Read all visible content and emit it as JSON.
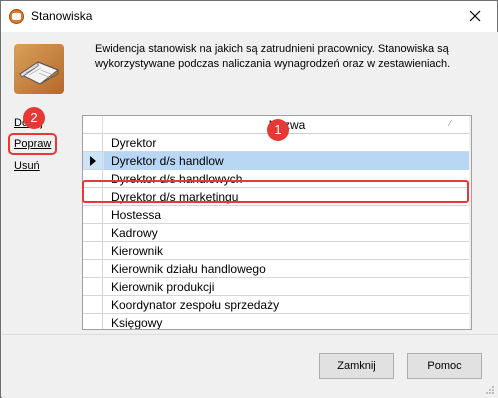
{
  "window": {
    "title": "Stanowiska",
    "close_glyph": "✕"
  },
  "description": "Ewidencja stanowisk na jakich są zatrudnieni pracownicy. Stanowiska są wykorzystywane podczas naliczania wynagrodzeń oraz w zestawieniach.",
  "side_actions": {
    "add": "Dodaj",
    "edit": "Popraw",
    "delete": "Usuń"
  },
  "grid": {
    "column": "Nazwa",
    "rows": [
      "Dyrektor",
      "Dyrektor d/s handlow",
      "Dyrektor d/s handlowych",
      "Dyrektor d/s marketingu",
      "Hostessa",
      "Kadrowy",
      "Kierownik",
      "Kierownik działu handlowego",
      "Kierownik produkcji",
      "Koordynator zespołu sprzedaży",
      "Księgowy"
    ],
    "selected_index": 1
  },
  "badges": {
    "grid_badge": "1",
    "edit_badge": "2"
  },
  "footer": {
    "close_label": "Zamknij",
    "help_label": "Pomoc"
  },
  "colors": {
    "highlight": "#e53935",
    "selection": "#b7d7f5"
  },
  "icons": {
    "app": "app-logo-icon",
    "header": "book-icon",
    "close": "close-icon",
    "sort": "sort-icon"
  }
}
